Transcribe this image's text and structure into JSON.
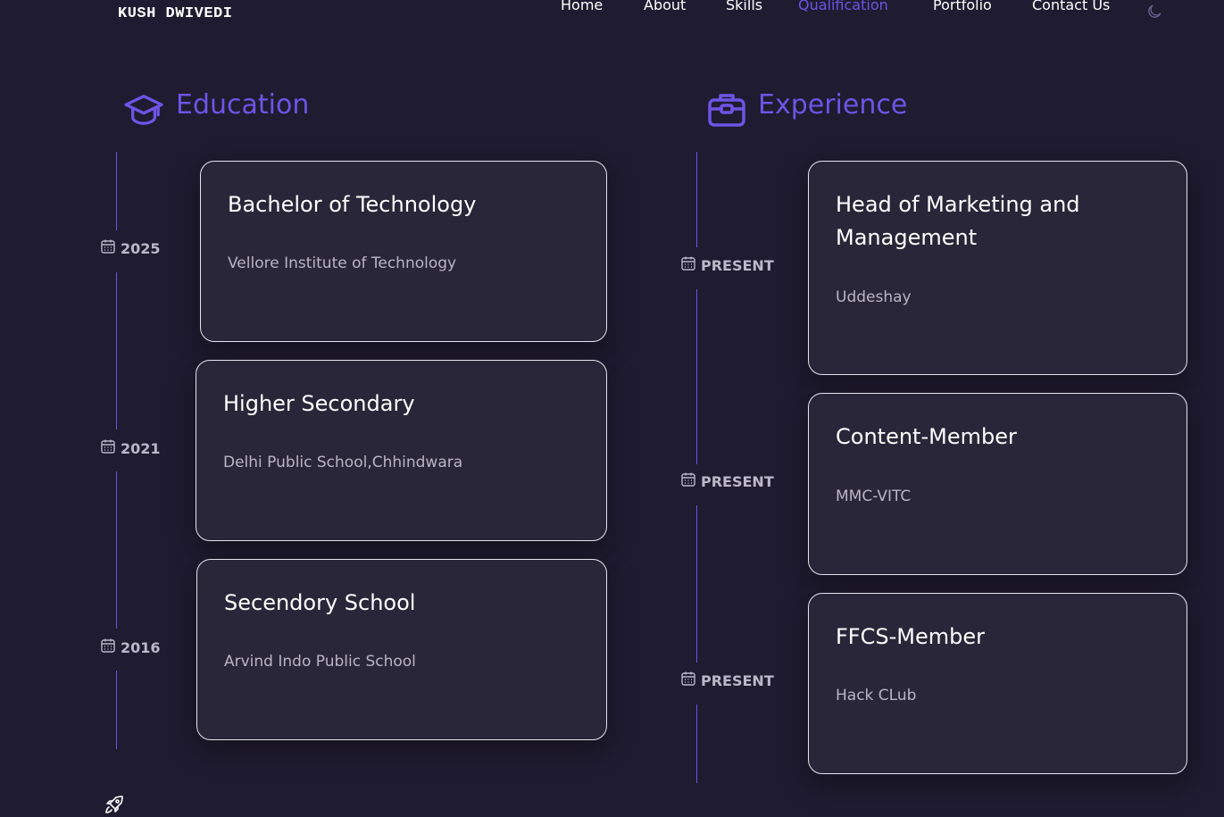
{
  "header": {
    "brand": "KUSH DWIVEDI",
    "nav": [
      "Home",
      "About",
      "Skills",
      "Qualification",
      "Portfolio",
      "Contact Us"
    ],
    "active_nav": "Qualification",
    "theme_icon": "moon-icon"
  },
  "education": {
    "title": "Education",
    "icon": "graduation-cap-icon",
    "items": [
      {
        "title": "Bachelor of Technology",
        "subtitle": "Vellore Institute of Technology",
        "date": "2025"
      },
      {
        "title": "Higher Secondary",
        "subtitle": "Delhi Public School,Chhindwara",
        "date": "2021"
      },
      {
        "title": "Secendory School",
        "subtitle": "Arvind Indo Public School",
        "date": "2016"
      }
    ]
  },
  "experience": {
    "title": "Experience",
    "icon": "briefcase-icon",
    "items": [
      {
        "title": "Head of Marketing and Management",
        "subtitle": "Uddeshay",
        "date": "PRESENT"
      },
      {
        "title": "Content-Member",
        "subtitle": "MMC-VITC",
        "date": "PRESENT"
      },
      {
        "title": "FFCS-Member",
        "subtitle": "Hack CLub",
        "date": "PRESENT"
      }
    ]
  },
  "scroll_up_icon": "rocket-icon",
  "colors": {
    "background": "#1f1b30",
    "card": "#2a2639",
    "accent": "#6d54e6",
    "text": "#ffffff",
    "muted": "#b9b5c6"
  }
}
